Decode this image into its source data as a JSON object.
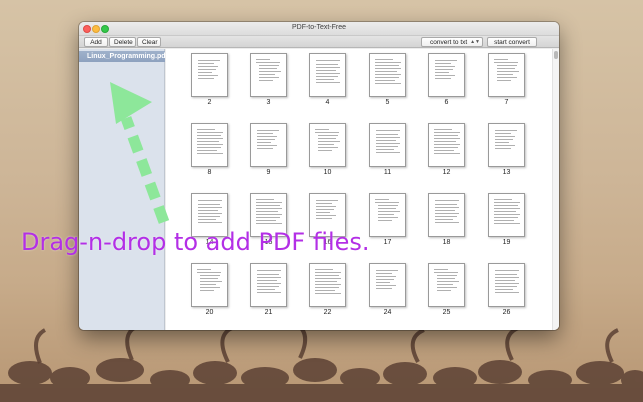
{
  "window": {
    "title": "PDF-to-Text-Free"
  },
  "toolbar": {
    "add_label": "Add",
    "delete_label": "Delete",
    "clear_label": "Clear",
    "format_select_value": "convert to txt",
    "convert_label": "start convert"
  },
  "sidebar": {
    "items": [
      {
        "label": "Linux_Programming.pdf",
        "selected": true
      }
    ]
  },
  "pages": [
    "2",
    "3",
    "4",
    "5",
    "6",
    "7",
    "8",
    "9",
    "10",
    "11",
    "12",
    "13",
    "14",
    "15",
    "16",
    "17",
    "18",
    "19",
    "20",
    "21",
    "22",
    "24",
    "25",
    "26"
  ],
  "overlay": {
    "text": "Drag-n-drop to add PDF files.",
    "text_color": "#b32fe6",
    "arrow_color": "#8de79a"
  },
  "colors": {
    "sidebar_selection": "#9fb1cb",
    "close": "#fc605c",
    "minimize": "#fdbc40",
    "maximize": "#34c84a"
  }
}
